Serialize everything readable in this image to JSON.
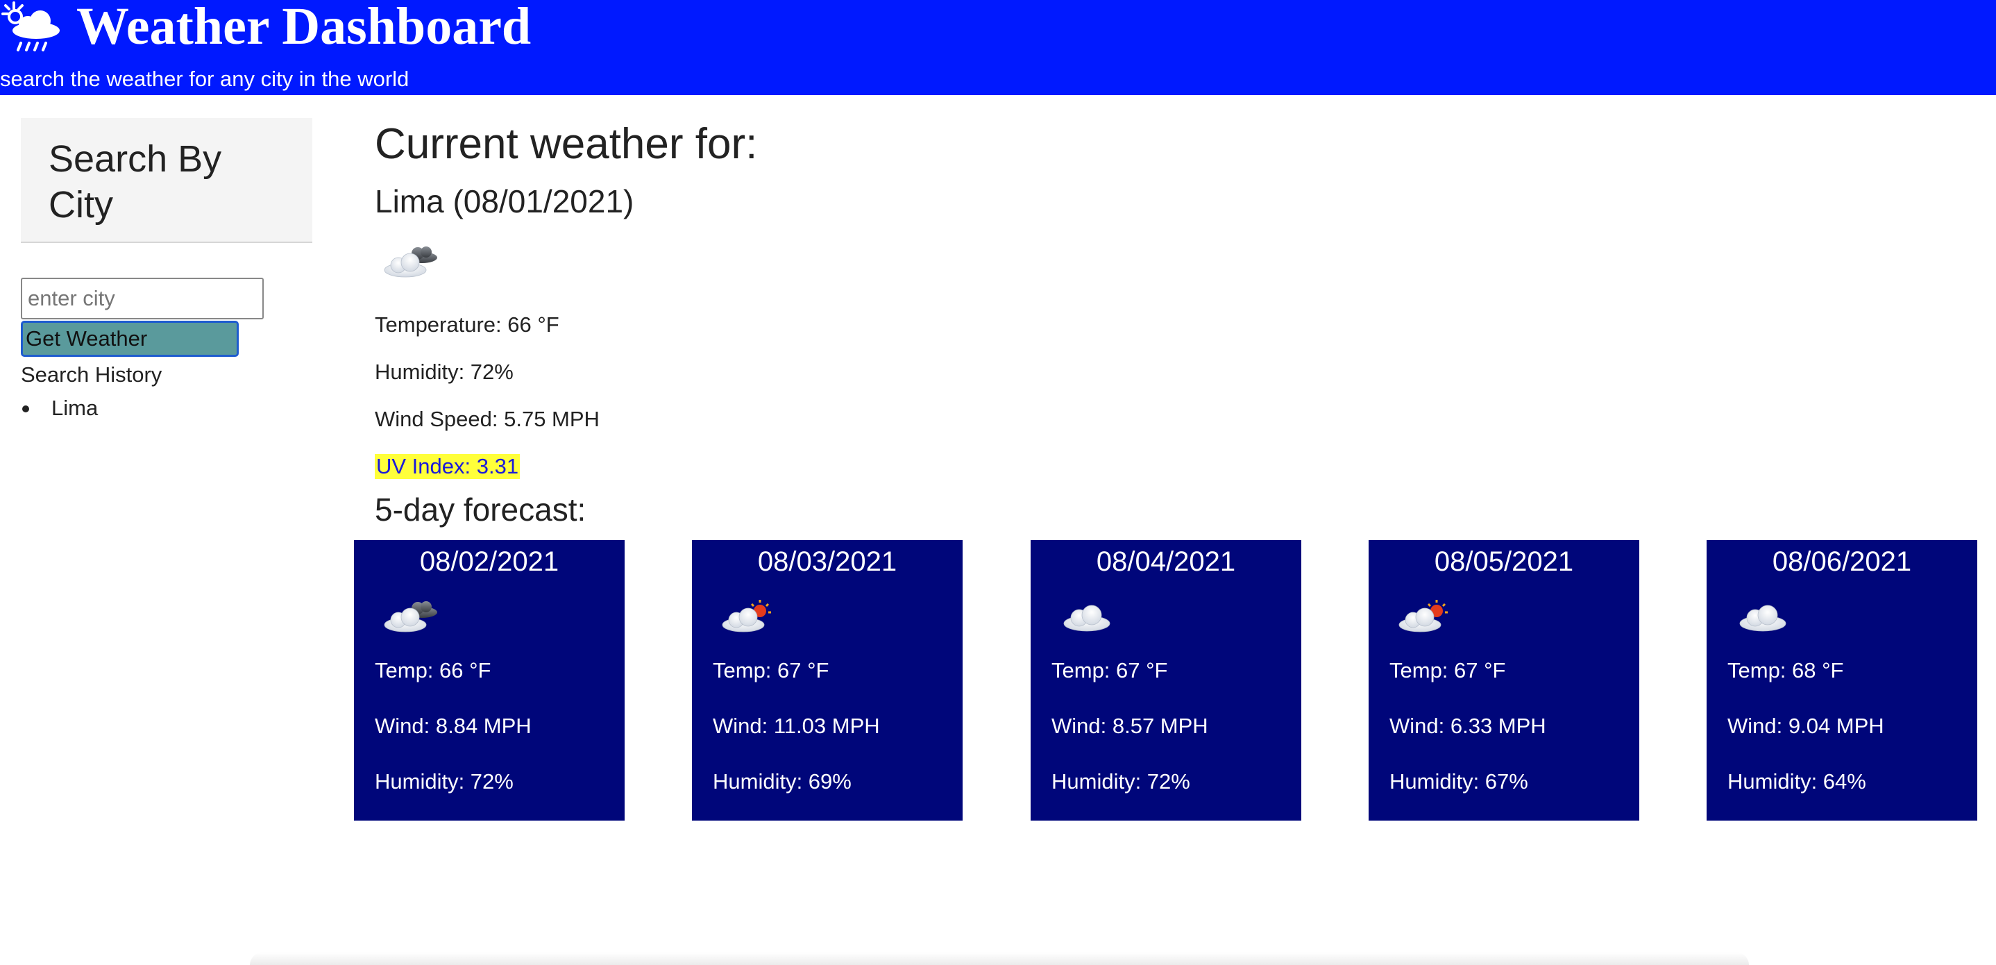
{
  "header": {
    "title": "Weather Dashboard",
    "subtitle": "search the weather for any city in the world",
    "logo_icon": "sun-cloud-rain-icon",
    "background_color": "#0019ff"
  },
  "sidebar": {
    "heading": "Search By City",
    "input_placeholder": "enter city",
    "input_value": "",
    "button_label": "Get Weather",
    "history_title": "Search History",
    "history": [
      "Lima"
    ]
  },
  "current": {
    "heading": "Current weather for:",
    "city_date": "Lima (08/01/2021)",
    "icon": "broken-clouds-icon",
    "temperature": "Temperature: 66 °F",
    "humidity": "Humidity: 72%",
    "wind": "Wind Speed: 5.75 MPH",
    "uv": "UV Index: 3.31",
    "uv_highlight_color": "#ffff3a"
  },
  "forecast": {
    "heading": "5-day forecast:",
    "card_color": "#00067a",
    "days": [
      {
        "date": "08/02/2021",
        "icon": "broken-clouds-icon",
        "temp": "Temp: 66 °F",
        "wind": "Wind: 8.84 MPH",
        "humidity": "Humidity: 72%"
      },
      {
        "date": "08/03/2021",
        "icon": "sun-cloud-icon",
        "temp": "Temp: 67 °F",
        "wind": "Wind: 11.03 MPH",
        "humidity": "Humidity: 69%"
      },
      {
        "date": "08/04/2021",
        "icon": "cloud-icon",
        "temp": "Temp: 67 °F",
        "wind": "Wind: 8.57 MPH",
        "humidity": "Humidity: 72%"
      },
      {
        "date": "08/05/2021",
        "icon": "sun-cloud-icon",
        "temp": "Temp: 67 °F",
        "wind": "Wind: 6.33 MPH",
        "humidity": "Humidity: 67%"
      },
      {
        "date": "08/06/2021",
        "icon": "cloud-icon",
        "temp": "Temp: 68 °F",
        "wind": "Wind: 9.04 MPH",
        "humidity": "Humidity: 64%"
      }
    ]
  }
}
